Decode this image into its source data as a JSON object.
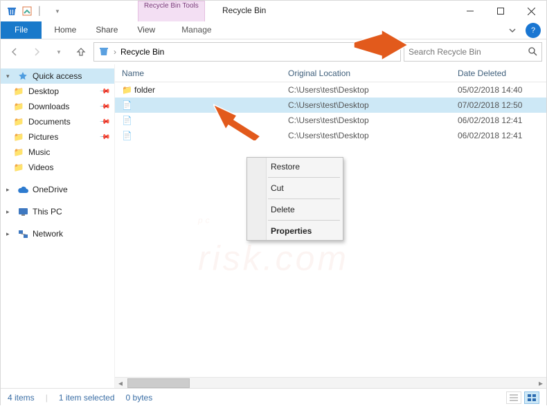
{
  "window": {
    "title": "Recycle Bin",
    "tools_label": "Recycle Bin Tools",
    "tools_tab": "Manage"
  },
  "menubar": {
    "file": "File",
    "home": "Home",
    "share": "Share",
    "view": "View",
    "manage": "Manage"
  },
  "address": {
    "location": "Recycle Bin"
  },
  "search": {
    "placeholder": "Search Recycle Bin"
  },
  "sidebar": {
    "quick_access": "Quick access",
    "items_quick": [
      {
        "label": "Desktop",
        "pinned": true
      },
      {
        "label": "Downloads",
        "pinned": true
      },
      {
        "label": "Documents",
        "pinned": true
      },
      {
        "label": "Pictures",
        "pinned": true
      },
      {
        "label": "Music",
        "pinned": false
      },
      {
        "label": "Videos",
        "pinned": false
      }
    ],
    "onedrive": "OneDrive",
    "this_pc": "This PC",
    "network": "Network"
  },
  "columns": {
    "name": "Name",
    "location": "Original Location",
    "date": "Date Deleted"
  },
  "rows": [
    {
      "name": "folder",
      "location": "C:\\Users\\test\\Desktop",
      "date": "05/02/2018 14:40",
      "selected": false,
      "icon": "folder"
    },
    {
      "name": "",
      "location": "C:\\Users\\test\\Desktop",
      "date": "07/02/2018 12:50",
      "selected": true,
      "icon": "file"
    },
    {
      "name": "",
      "location": "C:\\Users\\test\\Desktop",
      "date": "06/02/2018 12:41",
      "selected": false,
      "icon": "file"
    },
    {
      "name": "",
      "location": "C:\\Users\\test\\Desktop",
      "date": "06/02/2018 12:41",
      "selected": false,
      "icon": "file"
    }
  ],
  "context_menu": {
    "restore": "Restore",
    "cut": "Cut",
    "delete": "Delete",
    "properties": "Properties"
  },
  "status": {
    "items": "4 items",
    "selected": "1 item selected",
    "size": "0 bytes"
  },
  "watermark": {
    "line1": "pc",
    "line2": "risk.com"
  }
}
